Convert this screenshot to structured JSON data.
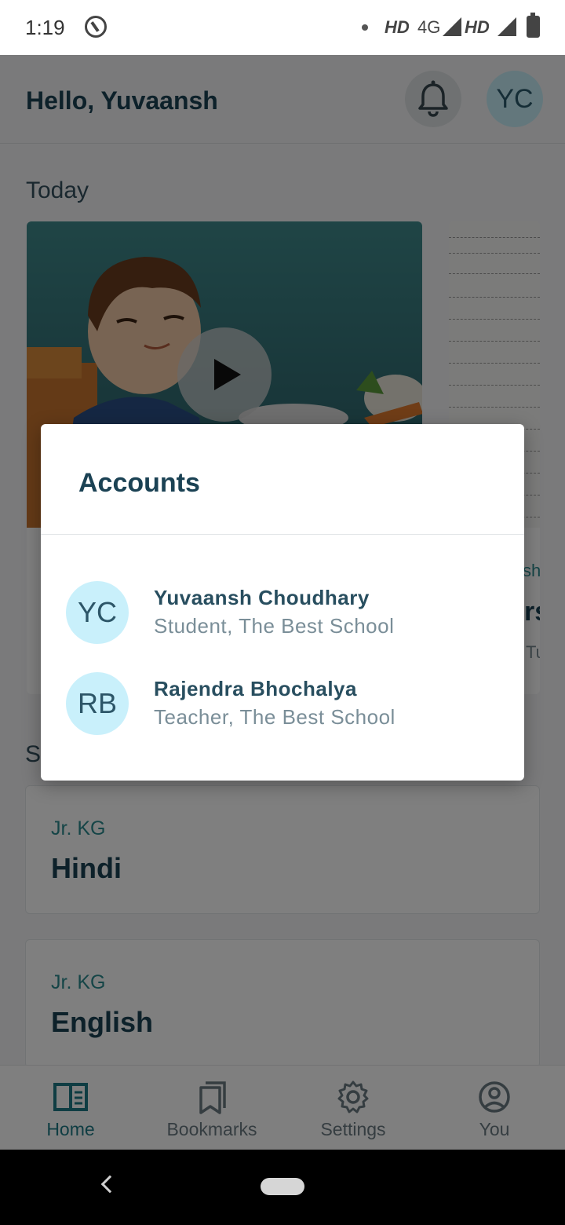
{
  "status_bar": {
    "time": "1:19",
    "network_1": "HD",
    "network_type": "4G",
    "network_2": "HD"
  },
  "header": {
    "greeting": "Hello, Yuvaansh",
    "avatar_initials": "YC"
  },
  "today": {
    "label": "Today",
    "card2": {
      "tag": "sh",
      "title": "rs",
      "subtitle": "Tu"
    }
  },
  "subjects": {
    "section_label_partial": "S",
    "items": [
      {
        "grade": "Jr. KG",
        "name": "Hindi"
      },
      {
        "grade": "Jr. KG",
        "name": "English"
      }
    ]
  },
  "bottom_nav": {
    "items": [
      {
        "label": "Home",
        "icon": "book-open-icon",
        "active": true
      },
      {
        "label": "Bookmarks",
        "icon": "bookmarks-icon",
        "active": false
      },
      {
        "label": "Settings",
        "icon": "gear-icon",
        "active": false
      },
      {
        "label": "You",
        "icon": "user-circle-icon",
        "active": false
      }
    ]
  },
  "dialog": {
    "title": "Accounts",
    "accounts": [
      {
        "initials": "YC",
        "name": "Yuvaansh Choudhary",
        "role": "Student, The Best School"
      },
      {
        "initials": "RB",
        "name": "Rajendra Bhochalya",
        "role": "Teacher, The Best School"
      }
    ]
  },
  "colors": {
    "primary_dark": "#1b4254",
    "accent_teal": "#1e7a86",
    "avatar_bg": "#c9f0fb"
  }
}
